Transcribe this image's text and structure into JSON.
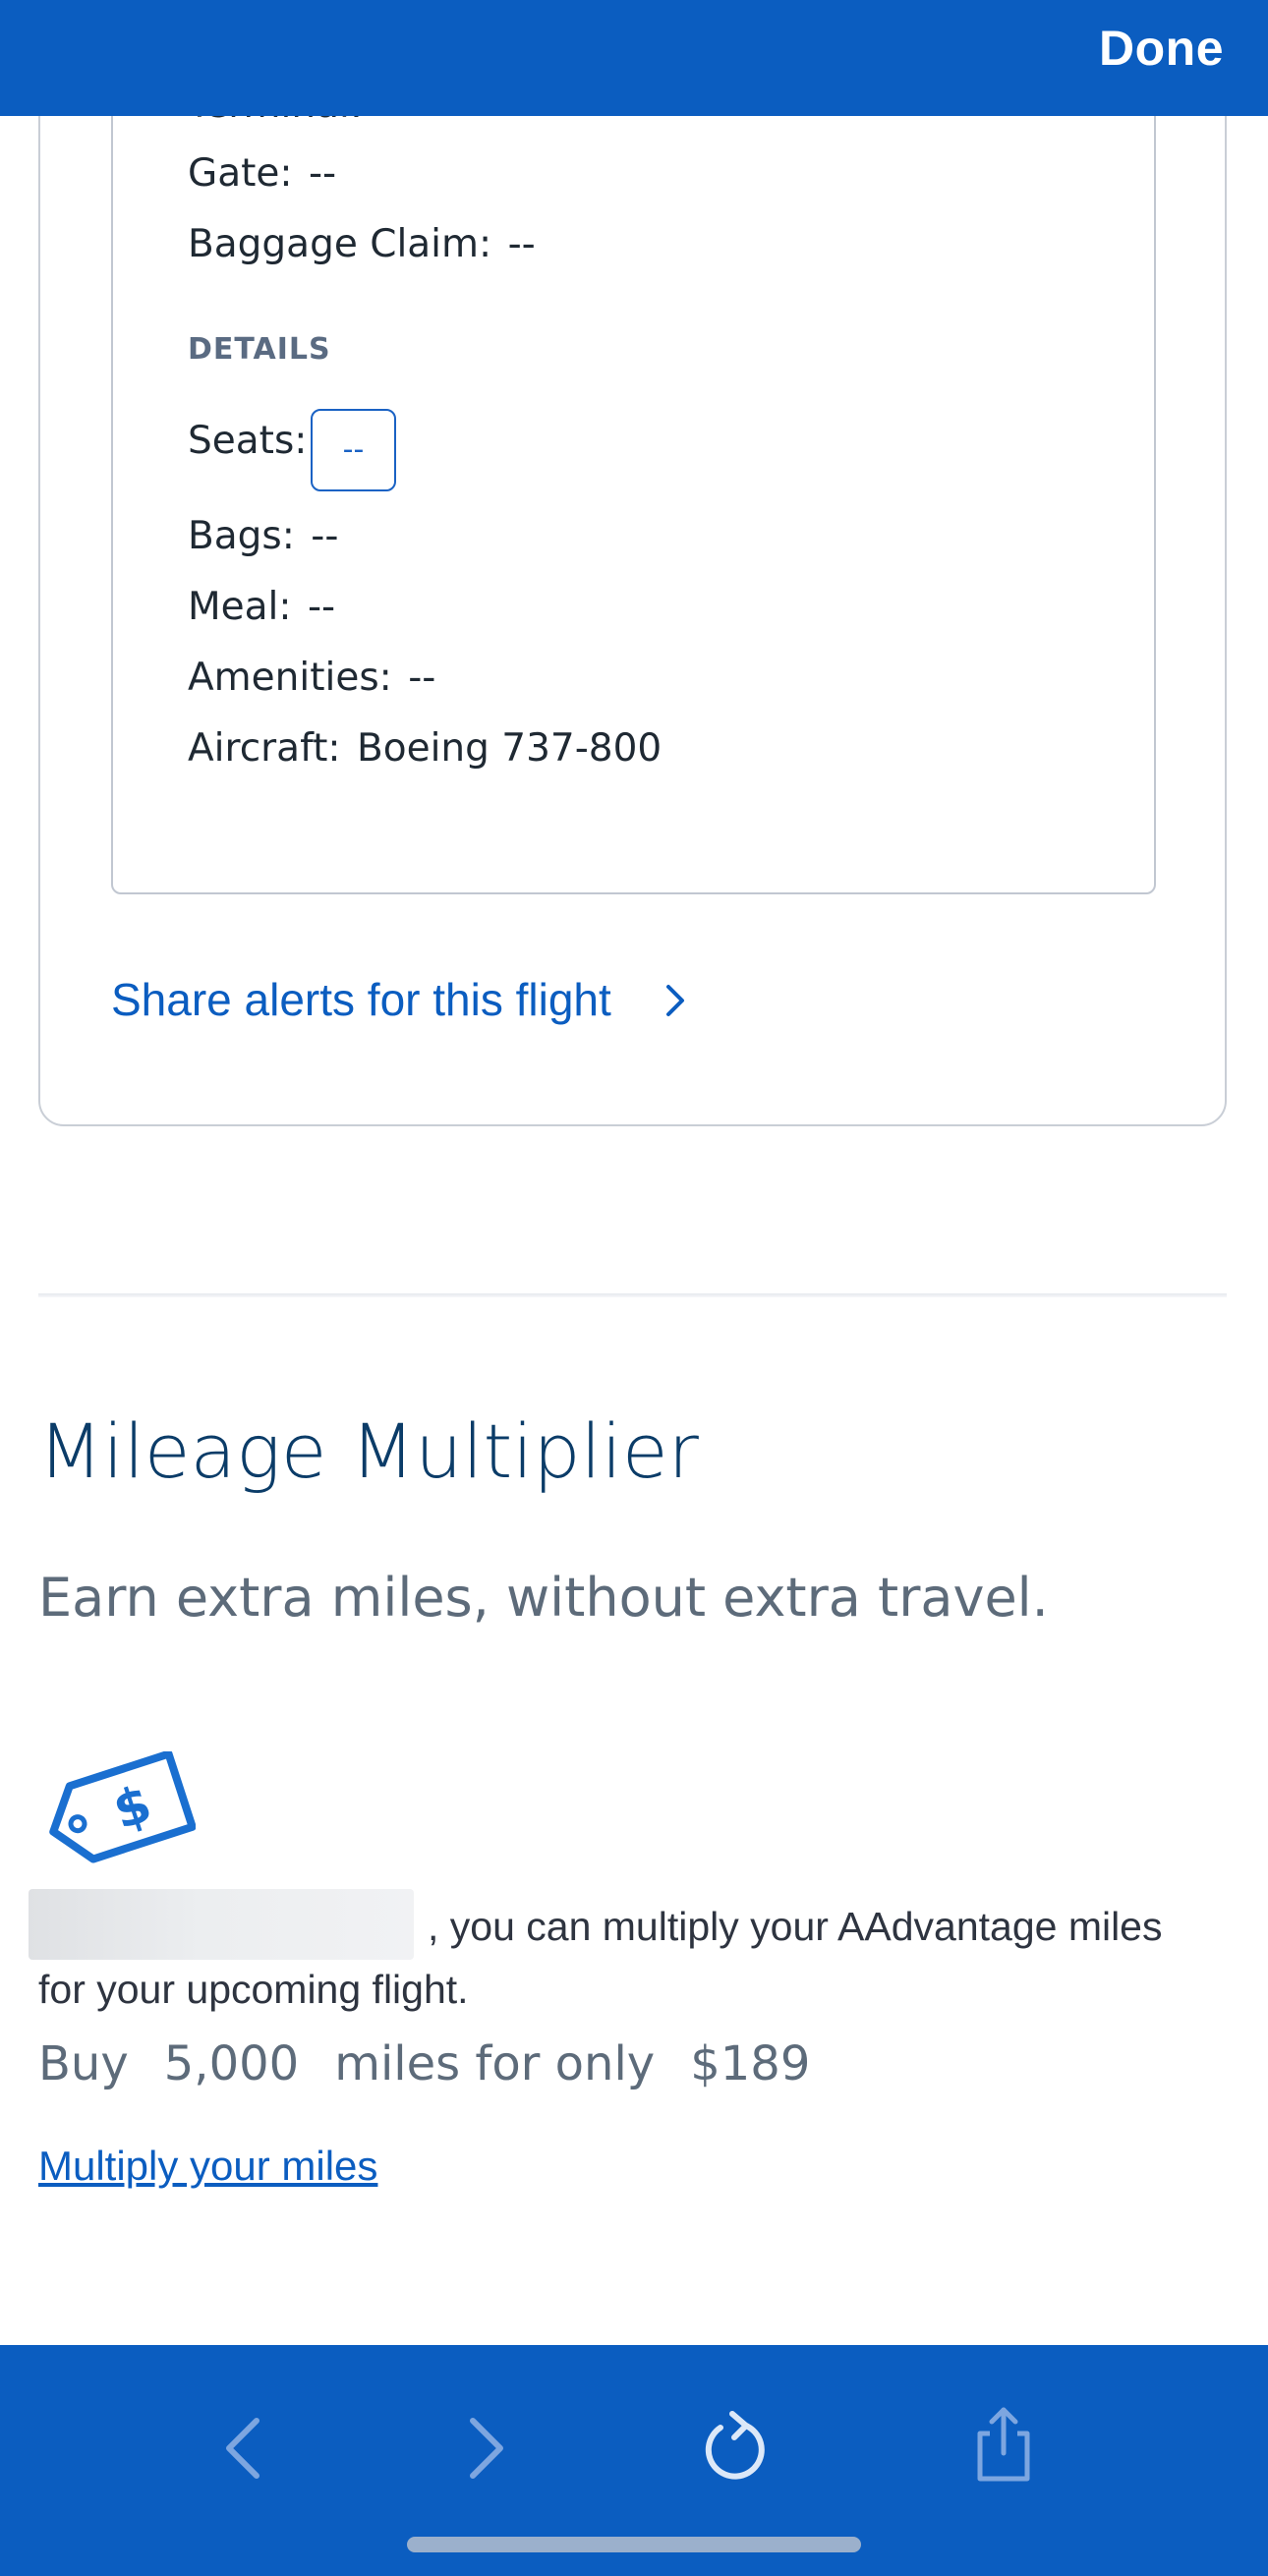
{
  "header": {
    "done_label": "Done"
  },
  "flight_details": {
    "terminal_label": "Terminal:",
    "gate_label": "Gate:",
    "gate_value": "--",
    "baggage_label": "Baggage Claim:",
    "baggage_value": "--",
    "details_section_title": "DETAILS",
    "seats_label": "Seats:",
    "seats_value": "--",
    "bags_label": "Bags:",
    "bags_value": "--",
    "meal_label": "Meal:",
    "meal_value": "--",
    "amenities_label": "Amenities:",
    "amenities_value": "--",
    "aircraft_label": "Aircraft:",
    "aircraft_value": "Boeing 737-800"
  },
  "share": {
    "label": "Share alerts for this flight"
  },
  "mileage_multiplier": {
    "title": "Mileage Multiplier",
    "subtitle": "Earn extra miles, without extra travel.",
    "body": ", you can multiply your AAdvantage miles for your upcoming flight.",
    "buy_prefix": "Buy",
    "miles_amount": "5,000",
    "miles_suffix": "miles for only",
    "price": "$189",
    "link_label": "Multiply your miles"
  },
  "toolbar": {
    "icons": [
      "back-icon",
      "forward-icon",
      "reload-icon",
      "share-icon"
    ]
  },
  "colors": {
    "brand_blue": "#0b5dc0",
    "title_navy": "#0b3c68"
  }
}
